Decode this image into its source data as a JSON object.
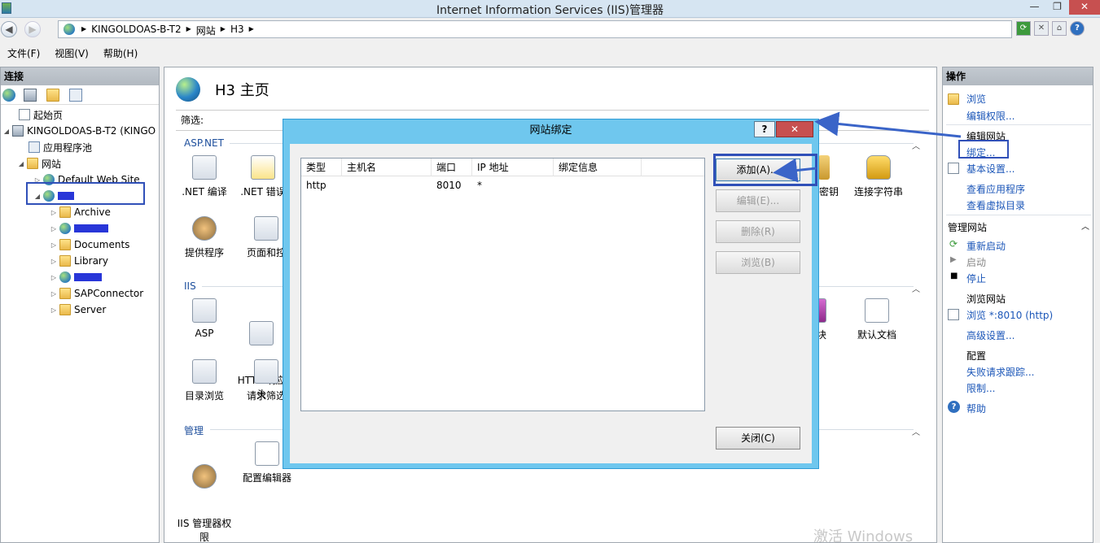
{
  "window": {
    "title": "Internet Information Services (IIS)管理器",
    "buttons": {
      "min": "—",
      "max": "❐",
      "close": "✕"
    }
  },
  "addressbar": {
    "crumbs": [
      "KINGOLDOAS-B-T2",
      "网站",
      "H3"
    ],
    "crumb_sep": "▶"
  },
  "menu": [
    "文件(F)",
    "视图(V)",
    "帮助(H)"
  ],
  "connections": {
    "header": "连接",
    "tree": [
      {
        "label": "起始页"
      },
      {
        "label": "KINGOLDOAS-B-T2 (KINGO"
      },
      {
        "label": "应用程序池"
      },
      {
        "label": "网站"
      },
      {
        "label": "Default Web Site"
      },
      {
        "label": "Archive"
      },
      {
        "label": "Documents"
      },
      {
        "label": "Library"
      },
      {
        "label": "SAPConnector"
      },
      {
        "label": "Server"
      }
    ]
  },
  "main": {
    "title": "H3 主页",
    "filter_label": "筛选:",
    "groups": {
      "aspnet": "ASP.NET",
      "iis": "IIS",
      "manage": "管理"
    },
    "features": {
      "net_compile": ".NET 编译",
      "net_errors": ".NET 错误",
      "providers": "提供程序",
      "pages_controls": "页面和控",
      "machine_key": "机密钥",
      "conn_strings": "连接字符串",
      "asp": "ASP",
      "http_response": "HTTP 响应\n头",
      "modules": "块",
      "default_doc": "默认文档",
      "dir_browse": "目录浏览",
      "request_filter": "请求筛选",
      "iis_mgr_perm": "IIS 管理器权\n限",
      "config_editor": "配置编辑器"
    }
  },
  "actions": {
    "header": "操作",
    "browse": "浏览",
    "edit_perms": "编辑权限...",
    "edit_site_head": "编辑网站",
    "bindings": "绑定...",
    "basic_settings": "基本设置...",
    "view_apps": "查看应用程序",
    "view_vdirs": "查看虚拟目录",
    "manage_site_head": "管理网站",
    "restart": "重新启动",
    "start": "启动",
    "stop": "停止",
    "browse_site_head": "浏览网站",
    "browse_8010": "浏览 *:8010 (http)",
    "advanced": "高级设置...",
    "config_head": "配置",
    "failed_trace": "失败请求跟踪...",
    "limits": "限制...",
    "help": "帮助"
  },
  "dialog": {
    "title": "网站绑定",
    "help_btn": "?",
    "close_btn": "✕",
    "columns": [
      "类型",
      "主机名",
      "端口",
      "IP 地址",
      "绑定信息"
    ],
    "rows": [
      {
        "type": "http",
        "host": "",
        "port": "8010",
        "ip": "*",
        "info": ""
      }
    ],
    "buttons": {
      "add": "添加(A)...",
      "edit": "编辑(E)...",
      "remove": "删除(R)",
      "browse": "浏览(B)",
      "close": "关闭(C)"
    }
  },
  "watermark": "激活 Windows",
  "colors": {
    "dialog_frame": "#6fc7ee",
    "annotation": "#3050b8",
    "close_red": "#c75050"
  }
}
